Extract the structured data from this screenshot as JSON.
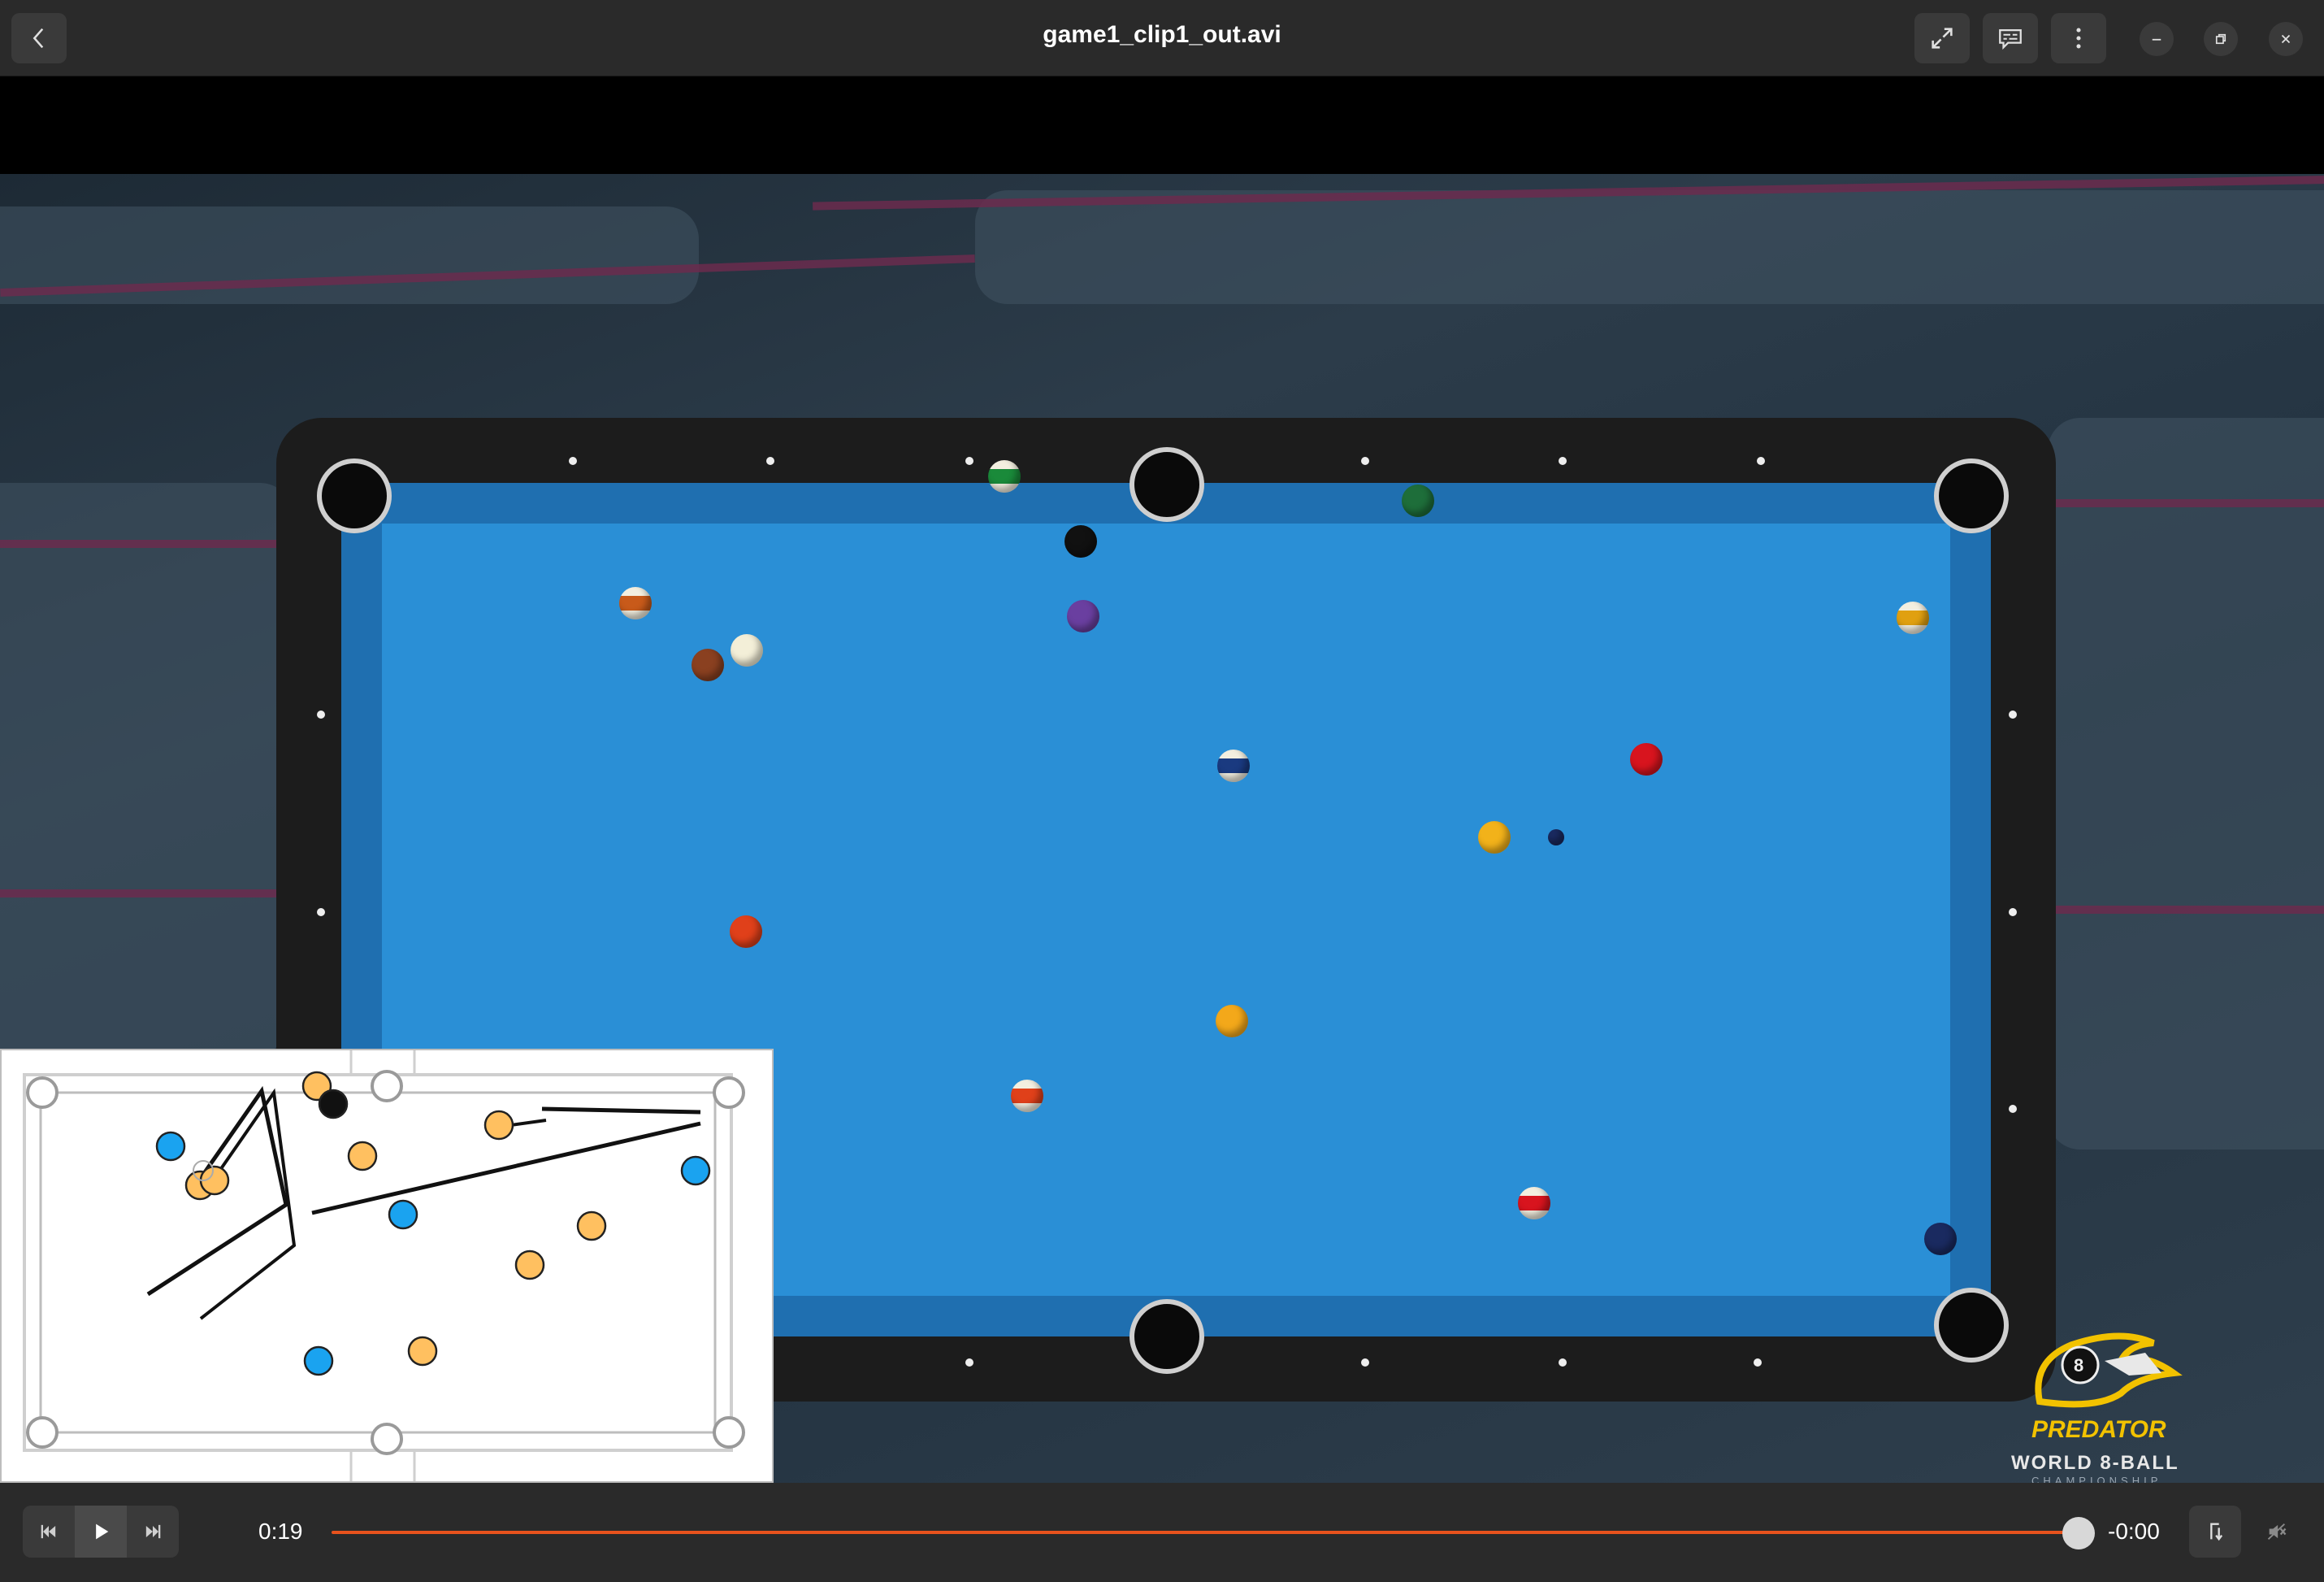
{
  "window": {
    "title": "game1_clip1_out.avi",
    "icons": {
      "back": "chevron-left-icon",
      "fullscreen": "expand-icon",
      "subtitles": "subtitles-icon",
      "menu": "more-vertical-icon",
      "minimize": "minimize-icon",
      "restore": "restore-icon",
      "close": "close-icon"
    }
  },
  "overlay": {
    "brand": "PREDATOR",
    "event_line1": "WORLD 8-BALL",
    "event_line2": "CHAMPIONSHIP"
  },
  "controls": {
    "elapsed": "0:19",
    "remaining": "-0:00",
    "progress": 0.99,
    "icons": {
      "previous": "skip-back-icon",
      "play": "play-icon",
      "next": "skip-forward-icon",
      "repeat": "repeat-icon",
      "volume": "volume-muted-icon"
    }
  },
  "colors": {
    "accent": "#e8521d",
    "felt": "#2a8fd6",
    "minimap_orange": "#ffc060",
    "minimap_blue": "#1aa3f0"
  }
}
